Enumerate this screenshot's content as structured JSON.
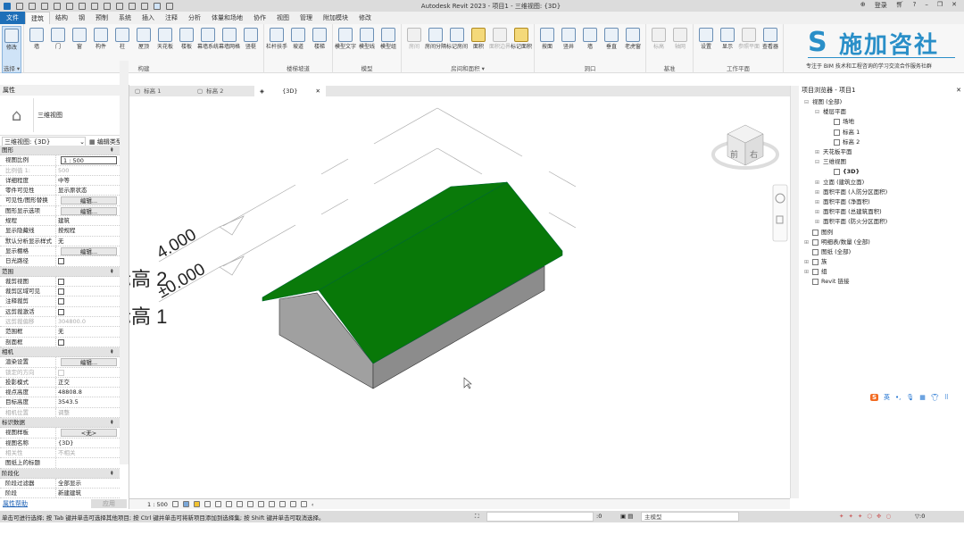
{
  "app_title": "Autodesk Revit 2023 - 项目1 - 三维视图: {3D}",
  "title_right": {
    "login": "登录",
    "help": "?"
  },
  "ribbon_tabs": [
    "文件",
    "建筑",
    "结构",
    "钢",
    "预制",
    "系统",
    "插入",
    "注释",
    "分析",
    "体量和场地",
    "协作",
    "视图",
    "管理",
    "附加模块",
    "修改"
  ],
  "active_tab": "建筑",
  "panels": [
    {
      "label": "选择 ▾",
      "buttons": [
        {
          "label": "修改",
          "state": "selected"
        }
      ]
    },
    {
      "label": "构建",
      "buttons": [
        {
          "label": "墙"
        },
        {
          "label": "门"
        },
        {
          "label": "窗"
        },
        {
          "label": "构件"
        },
        {
          "label": "柱"
        },
        {
          "label": "屋顶"
        },
        {
          "label": "天花板"
        },
        {
          "label": "楼板"
        },
        {
          "label": "幕墙系统"
        },
        {
          "label": "幕墙网格"
        },
        {
          "label": "竖梃"
        }
      ]
    },
    {
      "label": "楼梯坡道",
      "buttons": [
        {
          "label": "栏杆扶手"
        },
        {
          "label": "坡道"
        },
        {
          "label": "楼梯"
        }
      ]
    },
    {
      "label": "模型",
      "buttons": [
        {
          "label": "模型文字"
        },
        {
          "label": "模型线"
        },
        {
          "label": "模型组"
        }
      ]
    },
    {
      "label": "房间和面积 ▾",
      "buttons": [
        {
          "label": "房间",
          "state": "disabled"
        },
        {
          "label": "房间分隔"
        },
        {
          "label": "标记房间"
        },
        {
          "label": "面积",
          "state": "yellow"
        },
        {
          "label": "面积边界",
          "state": "disabled"
        },
        {
          "label": "标记面积",
          "state": "yellow"
        }
      ]
    },
    {
      "label": "洞口",
      "buttons": [
        {
          "label": "按面"
        },
        {
          "label": "竖井"
        },
        {
          "label": "墙"
        },
        {
          "label": "垂直"
        },
        {
          "label": "老虎窗"
        }
      ]
    },
    {
      "label": "基准",
      "buttons": [
        {
          "label": "标高",
          "state": "disabled"
        },
        {
          "label": "轴网",
          "state": "disabled"
        }
      ]
    },
    {
      "label": "工作平面",
      "buttons": [
        {
          "label": "设置"
        },
        {
          "label": "显示"
        },
        {
          "label": "参照平面",
          "state": "disabled"
        },
        {
          "label": "查看器"
        }
      ]
    }
  ],
  "logo": {
    "text": "施加咨社",
    "subtitle": "专注于 BIM 技术和工程咨询的学习交流合作服务社群"
  },
  "properties": {
    "title": "属性",
    "type_name": "三维视图",
    "instance_selector": "三维视图: {3D}",
    "edit_type": "编辑类型",
    "rows": [
      {
        "h": "图形"
      },
      {
        "k": "视图比例",
        "v": "1 : 500",
        "t": "input"
      },
      {
        "k": "比例值 1:",
        "v": "500",
        "t": "gray"
      },
      {
        "k": "详细程度",
        "v": "中等"
      },
      {
        "k": "零件可见性",
        "v": "显示原状态"
      },
      {
        "k": "可见性/图形替换",
        "v": "编辑...",
        "t": "btn"
      },
      {
        "k": "图形显示选项",
        "v": "编辑...",
        "t": "btn"
      },
      {
        "k": "规程",
        "v": "建筑"
      },
      {
        "k": "显示隐藏线",
        "v": "按规程"
      },
      {
        "k": "默认分析显示样式",
        "v": "无"
      },
      {
        "k": "显示棚格",
        "v": "编辑...",
        "t": "btn"
      },
      {
        "k": "日光路径",
        "v": false,
        "t": "cb"
      },
      {
        "h": "范围"
      },
      {
        "k": "裁剪视图",
        "v": false,
        "t": "cb"
      },
      {
        "k": "裁剪区域可见",
        "v": false,
        "t": "cb"
      },
      {
        "k": "注释裁剪",
        "v": false,
        "t": "cb"
      },
      {
        "k": "远剪裁激活",
        "v": false,
        "t": "cb"
      },
      {
        "k": "远剪裁偏移",
        "v": "304800.0",
        "t": "gray"
      },
      {
        "k": "范围框",
        "v": "无"
      },
      {
        "k": "剖面框",
        "v": false,
        "t": "cb"
      },
      {
        "h": "相机"
      },
      {
        "k": "渲染设置",
        "v": "编辑...",
        "t": "btn"
      },
      {
        "k": "锁定的方向",
        "v": false,
        "t": "graycb"
      },
      {
        "k": "投影模式",
        "v": "正交"
      },
      {
        "k": "视点高度",
        "v": "48808.8"
      },
      {
        "k": "目标高度",
        "v": "3543.5"
      },
      {
        "k": "相机位置",
        "v": "调整",
        "t": "gray"
      },
      {
        "h": "标识数据"
      },
      {
        "k": "视图样板",
        "v": "<无>",
        "t": "btn"
      },
      {
        "k": "视图名称",
        "v": "{3D}"
      },
      {
        "k": "相关性",
        "v": "不相关",
        "t": "gray"
      },
      {
        "k": "图纸上的标题",
        "v": ""
      },
      {
        "h": "阶段化"
      },
      {
        "k": "阶段过滤器",
        "v": "全部显示"
      },
      {
        "k": "阶段",
        "v": "新建建筑"
      }
    ],
    "help_link": "属性帮助",
    "apply": "应用"
  },
  "view_tabs": [
    {
      "label": "标高 1"
    },
    {
      "label": "标高 2"
    },
    {
      "label": "{3D}",
      "active": true
    }
  ],
  "viewport": {
    "levels": [
      {
        "name": "标高 2",
        "elevation": "4.000"
      },
      {
        "name": "标高 1",
        "elevation": "±0.000"
      }
    ],
    "viewcube": {
      "front": "前",
      "right": "右"
    },
    "roof_color": "#0a7a0a",
    "wall_color": "#8c8c8c"
  },
  "view_control": {
    "scale": "1 : 500"
  },
  "browser": {
    "title": "项目浏览器 - 项目1",
    "items": [
      {
        "l": 0,
        "t": "视图 (全部)",
        "tg": "−"
      },
      {
        "l": 1,
        "t": "楼层平面",
        "tg": "−"
      },
      {
        "l": 2,
        "t": "场地",
        "icon": true
      },
      {
        "l": 2,
        "t": "标高 1",
        "icon": true
      },
      {
        "l": 2,
        "t": "标高 2",
        "icon": true
      },
      {
        "l": 1,
        "t": "天花板平面",
        "tg": "+"
      },
      {
        "l": 1,
        "t": "三维视图",
        "tg": "−"
      },
      {
        "l": 2,
        "t": "{3D}",
        "icon": true,
        "bold": true
      },
      {
        "l": 1,
        "t": "立面 (建筑立面)",
        "tg": "+"
      },
      {
        "l": 1,
        "t": "面积平面 (人防分区面积)",
        "tg": "+"
      },
      {
        "l": 1,
        "t": "面积平面 (净面积)",
        "tg": "+"
      },
      {
        "l": 1,
        "t": "面积平面 (总建筑面积)",
        "tg": "+"
      },
      {
        "l": 1,
        "t": "面积平面 (防火分区面积)",
        "tg": "+"
      },
      {
        "l": 0,
        "t": "图例",
        "icon": true
      },
      {
        "l": 0,
        "t": "明细表/数量 (全部)",
        "tg": "+",
        "icon": true
      },
      {
        "l": 0,
        "t": "图纸 (全部)",
        "icon": true
      },
      {
        "l": 0,
        "t": "族",
        "tg": "+",
        "icon": true
      },
      {
        "l": 0,
        "t": "组",
        "tg": "+",
        "icon": true
      },
      {
        "l": 0,
        "t": "Revit 链接",
        "icon": true
      }
    ]
  },
  "status": {
    "message": "单击可进行选择; 按 Tab 键并单击可选择其他项目; 按 Ctrl 键并单击可将新项目添加到选择集; 按 Shift 键并单击可取消选择。",
    "count": ":0",
    "model": "主模型",
    "filter": ":0"
  },
  "ime": {
    "label": "英"
  }
}
